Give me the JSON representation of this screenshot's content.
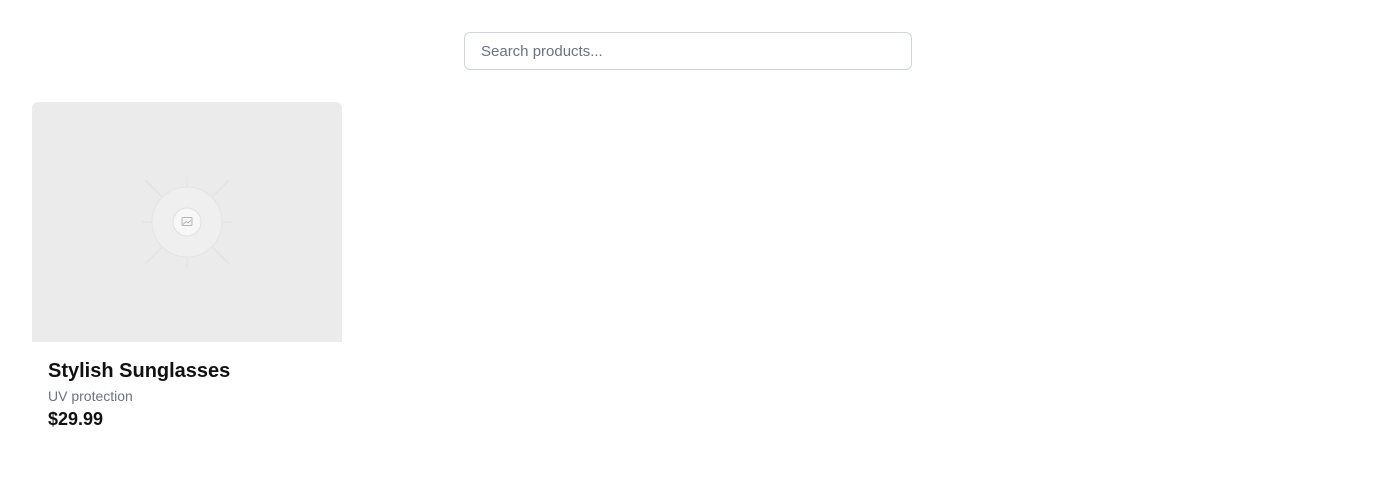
{
  "search": {
    "placeholder": "Search products...",
    "value": ""
  },
  "products": [
    {
      "name": "Stylish Sunglasses",
      "description": "UV protection",
      "price": "$29.99",
      "image_icon": "image-placeholder-icon"
    }
  ],
  "colors": {
    "image_background": "#ebebeb",
    "input_border": "#d1d5db",
    "muted_text": "#6b7280",
    "primary_text": "#111111"
  }
}
